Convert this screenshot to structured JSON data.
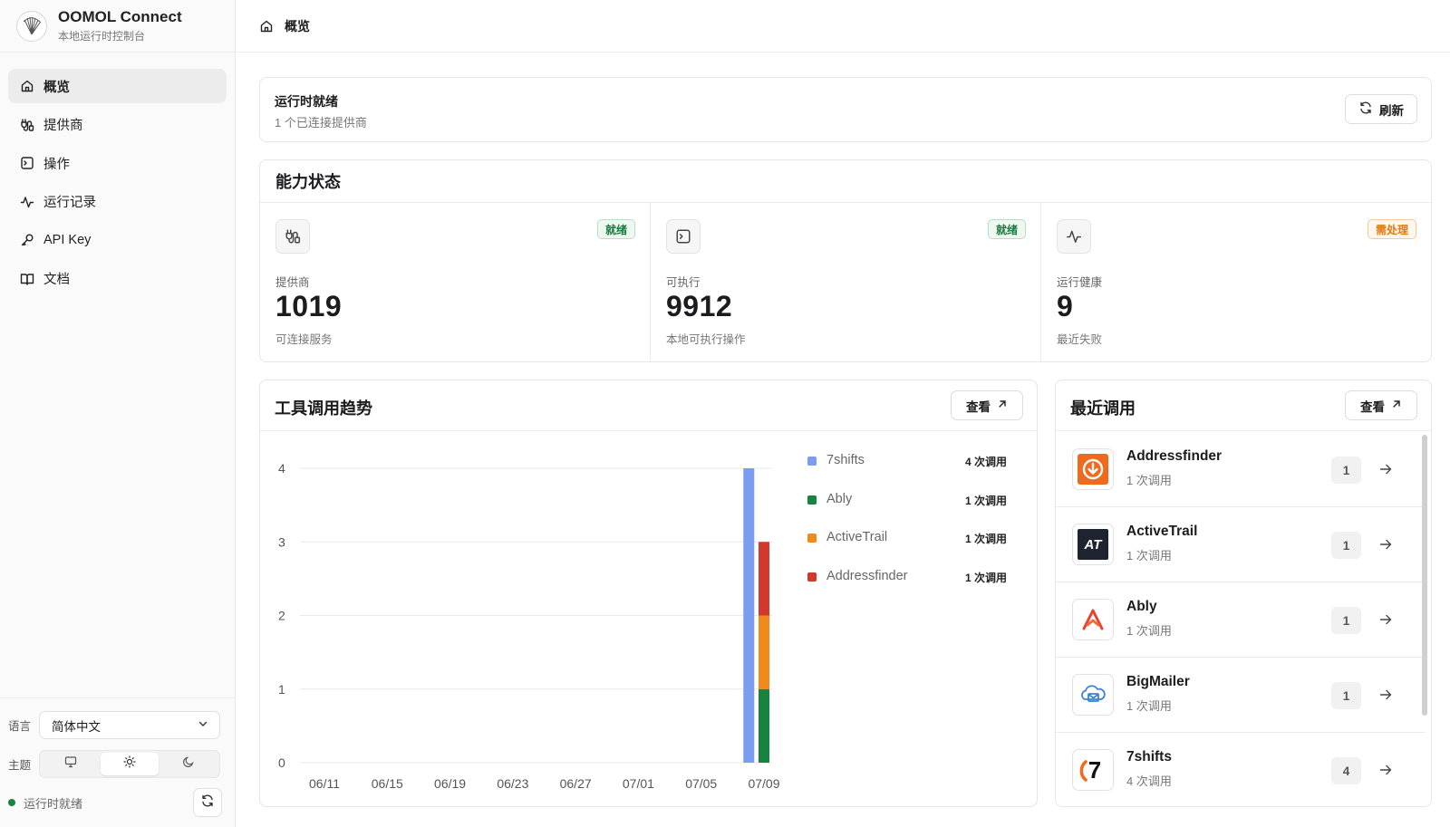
{
  "app": {
    "name": "OOMOL Connect",
    "subtitle": "本地运行时控制台"
  },
  "sidebar": {
    "items": [
      {
        "label": "概览",
        "icon": "home-icon",
        "active": true
      },
      {
        "label": "提供商",
        "icon": "plug-icon",
        "active": false
      },
      {
        "label": "操作",
        "icon": "terminal-icon",
        "active": false
      },
      {
        "label": "运行记录",
        "icon": "activity-icon",
        "active": false
      },
      {
        "label": "API Key",
        "icon": "key-icon",
        "active": false
      },
      {
        "label": "文档",
        "icon": "book-icon",
        "active": false
      }
    ],
    "language_label": "语言",
    "language_value": "简体中文",
    "theme_label": "主题",
    "theme_options": [
      "monitor-icon",
      "sun-icon",
      "moon-icon"
    ],
    "theme_active": "sun-icon",
    "status_text": "运行时就绪",
    "status_color": "#16833f"
  },
  "header": {
    "breadcrumb": "概览"
  },
  "ready": {
    "title": "运行时就绪",
    "subtitle": "1 个已连接提供商",
    "refresh_label": "刷新"
  },
  "capability": {
    "title": "能力状态",
    "cards": [
      {
        "label": "提供商",
        "value": "1019",
        "desc": "可连接服务",
        "badge": "就绪",
        "icon": "plug-icon"
      },
      {
        "label": "可执行",
        "value": "9912",
        "desc": "本地可执行操作",
        "badge": "就绪",
        "icon": "terminal-icon"
      },
      {
        "label": "运行健康",
        "value": "9",
        "desc": "最近失败",
        "badge": "需处理",
        "icon": "activity-icon"
      }
    ]
  },
  "trend": {
    "title": "工具调用趋势",
    "view_label": "查看",
    "legend": [
      {
        "name": "7shifts",
        "count": "4 次调用",
        "color": "#7b9cf0"
      },
      {
        "name": "Ably",
        "count": "1 次调用",
        "color": "#16833f"
      },
      {
        "name": "ActiveTrail",
        "count": "1 次调用",
        "color": "#f08a1c"
      },
      {
        "name": "Addressfinder",
        "count": "1 次调用",
        "color": "#d0392b"
      }
    ]
  },
  "chart_data": {
    "type": "bar",
    "stacked": true,
    "x_ticks": [
      "06/11",
      "06/15",
      "06/19",
      "06/23",
      "06/27",
      "07/01",
      "07/05",
      "07/09"
    ],
    "y_ticks": [
      "0",
      "1",
      "2",
      "3",
      "4"
    ],
    "ylim": [
      0,
      4
    ],
    "grid": true,
    "legend_position": "right",
    "bars": [
      {
        "date": "07/08",
        "stack": [
          {
            "series": "7shifts",
            "value": 4
          }
        ]
      },
      {
        "date": "07/09",
        "stack": [
          {
            "series": "Ably",
            "value": 1
          },
          {
            "series": "ActiveTrail",
            "value": 1
          },
          {
            "series": "Addressfinder",
            "value": 1
          }
        ]
      }
    ],
    "series": [
      {
        "name": "7shifts",
        "values": [
          4,
          0
        ],
        "color": "#7b9cf0"
      },
      {
        "name": "Ably",
        "values": [
          0,
          1
        ],
        "color": "#16833f"
      },
      {
        "name": "ActiveTrail",
        "values": [
          0,
          1
        ],
        "color": "#f08a1c"
      },
      {
        "name": "Addressfinder",
        "values": [
          0,
          1
        ],
        "color": "#d0392b"
      }
    ]
  },
  "recent": {
    "title": "最近调用",
    "view_label": "查看",
    "items": [
      {
        "name": "Addressfinder",
        "sub": "1 次调用",
        "count": "1",
        "logo": "addressfinder-logo"
      },
      {
        "name": "ActiveTrail",
        "sub": "1 次调用",
        "count": "1",
        "logo": "activetrail-logo",
        "logo_text": "AT"
      },
      {
        "name": "Ably",
        "sub": "1 次调用",
        "count": "1",
        "logo": "ably-logo"
      },
      {
        "name": "BigMailer",
        "sub": "1 次调用",
        "count": "1",
        "logo": "bigmailer-logo"
      },
      {
        "name": "7shifts",
        "sub": "4 次调用",
        "count": "4",
        "logo": "7shifts-logo",
        "logo_text": "7"
      }
    ]
  }
}
